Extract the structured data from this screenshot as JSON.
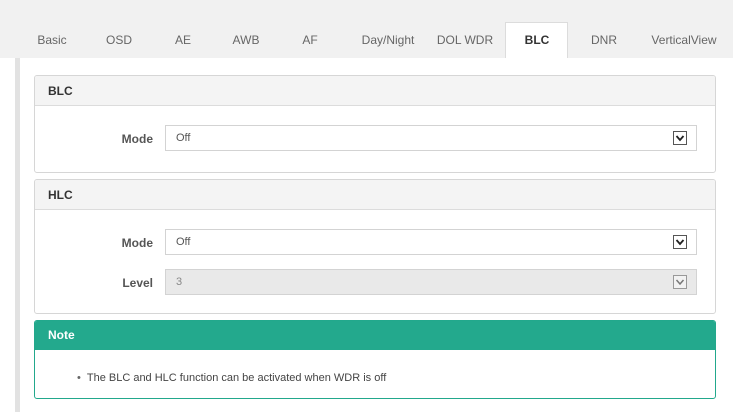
{
  "tabs": [
    {
      "label": "Basic"
    },
    {
      "label": "OSD"
    },
    {
      "label": "AE"
    },
    {
      "label": "AWB"
    },
    {
      "label": "AF"
    },
    {
      "label": "Day/Night"
    },
    {
      "label": "DOL WDR"
    },
    {
      "label": "BLC",
      "active": true
    },
    {
      "label": "DNR"
    },
    {
      "label": "VerticalView"
    }
  ],
  "blc": {
    "title": "BLC",
    "mode_label": "Mode",
    "mode_value": "Off"
  },
  "hlc": {
    "title": "HLC",
    "mode_label": "Mode",
    "mode_value": "Off",
    "level_label": "Level",
    "level_value": "3"
  },
  "note": {
    "title": "Note",
    "text": "The BLC and HLC function can be activated when WDR is off",
    "bullet": "•"
  },
  "colors": {
    "accent": "#23a98d",
    "tabbar_bg": "#f1f1f1",
    "panel_header_bg": "#f4f4f4"
  },
  "icons": {
    "select_arrow": "chevron-down-icon"
  }
}
